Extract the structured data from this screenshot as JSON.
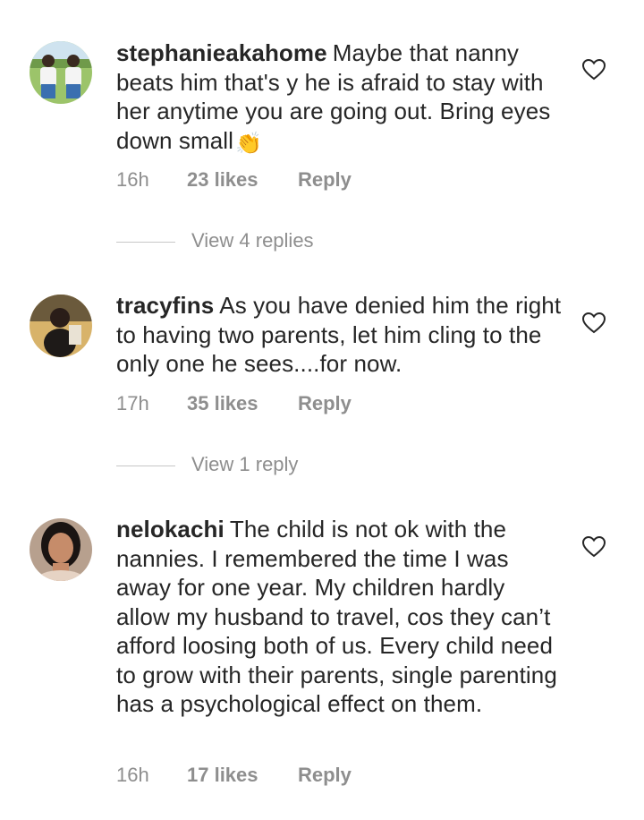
{
  "comments": [
    {
      "username": "stephanieakahome",
      "text": "Maybe that nanny beats him that's y he is afraid to stay with her anytime you are going out. Bring eyes down small",
      "emoji": "👏",
      "time": "16h",
      "likes": "23 likes",
      "reply_label": "Reply",
      "view_replies": "View 4 replies"
    },
    {
      "username": "tracyfins",
      "text": "As you have denied him the right to having two parents, let him cling to the only one he sees....for now.",
      "time": "17h",
      "likes": "35 likes",
      "reply_label": "Reply",
      "view_replies": "View 1 reply"
    },
    {
      "username": "nelokachi",
      "text": "The child is not ok with the nannies. I remembered the time I was away for one year. My children hardly allow my husband to travel, cos they can’t afford loosing both of us. Every child need to grow with their parents, single parenting has a psychological effect on them.",
      "time": "16h",
      "likes": "17 likes",
      "reply_label": "Reply"
    }
  ],
  "icons": {
    "heart": "heart-outline-icon"
  },
  "colors": {
    "text": "#262626",
    "secondary": "#8e8e8e",
    "divider": "#c7c7c7"
  }
}
